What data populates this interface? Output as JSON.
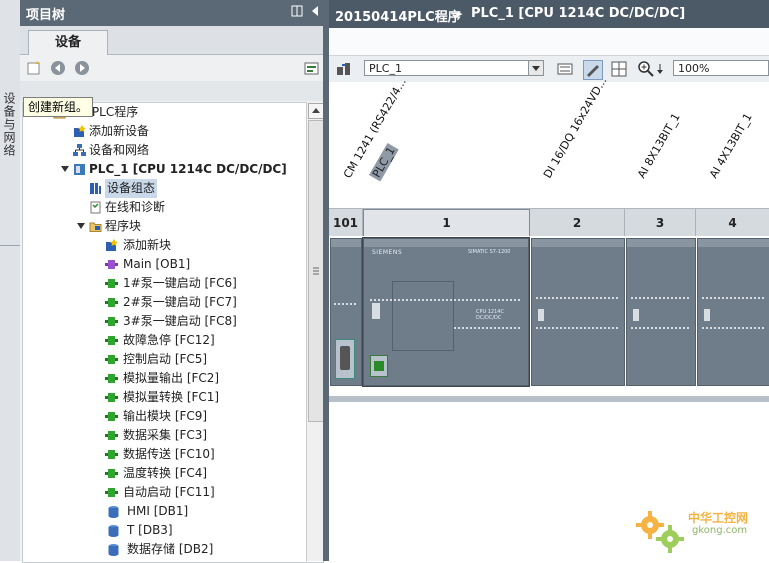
{
  "sidebar_strip": {
    "vertical_label": "设备与网络"
  },
  "tree": {
    "header_title": "项目树",
    "tab_label": "设备",
    "tooltip": "创建新组。",
    "root_label": "414PLC程序",
    "items": [
      {
        "label": "添加新设备"
      },
      {
        "label": "设备和网络"
      },
      {
        "label": "PLC_1 [CPU 1214C DC/DC/DC]"
      },
      {
        "label": "设备组态"
      },
      {
        "label": "在线和诊断"
      },
      {
        "label": "程序块"
      },
      {
        "label": "添加新块"
      },
      {
        "label": "Main [OB1]"
      },
      {
        "label": "1#泵一键启动 [FC6]"
      },
      {
        "label": "2#泵一键启动 [FC7]"
      },
      {
        "label": "3#泵一键启动 [FC8]"
      },
      {
        "label": "故障急停 [FC12]"
      },
      {
        "label": "控制启动 [FC5]"
      },
      {
        "label": "模拟量输出 [FC2]"
      },
      {
        "label": "模拟量转换 [FC1]"
      },
      {
        "label": "输出模块 [FC9]"
      },
      {
        "label": "数据采集 [FC3]"
      },
      {
        "label": "数据传送 [FC10]"
      },
      {
        "label": "温度转换 [FC4]"
      },
      {
        "label": "自动启动 [FC11]"
      },
      {
        "label": "HMI [DB1]"
      },
      {
        "label": "T [DB3]"
      },
      {
        "label": "数据存储 [DB2]"
      }
    ]
  },
  "editor": {
    "breadcrumb_project": "20150414PLC程序",
    "breadcrumb_sep": "▸",
    "breadcrumb_device": "PLC_1 [CPU 1214C DC/DC/DC]",
    "device_select": "PLC_1",
    "zoom_value": "100%",
    "module_labels": [
      "CM 1241 (RS422/4...",
      "PLC_1",
      "DI 16/DQ 16x24VD...",
      "AI 8X13BIT_1",
      "AI 4X13BIT_1"
    ],
    "slots": [
      "101",
      "1",
      "2",
      "3",
      "4"
    ],
    "cpu_brand": "SIEMENS",
    "cpu_model": "SIMATIC S7-1200",
    "cpu_type_text": "CPU 1214C DC/DC/DC"
  },
  "watermark": {
    "title": "中华工控网",
    "url": "gkong.com"
  },
  "colors": {
    "header_dark": "#5b6876",
    "breadcrumb_bg": "#4c5966",
    "module_grey": "#6f7c89",
    "selection_blue": "#c9d9ea"
  }
}
